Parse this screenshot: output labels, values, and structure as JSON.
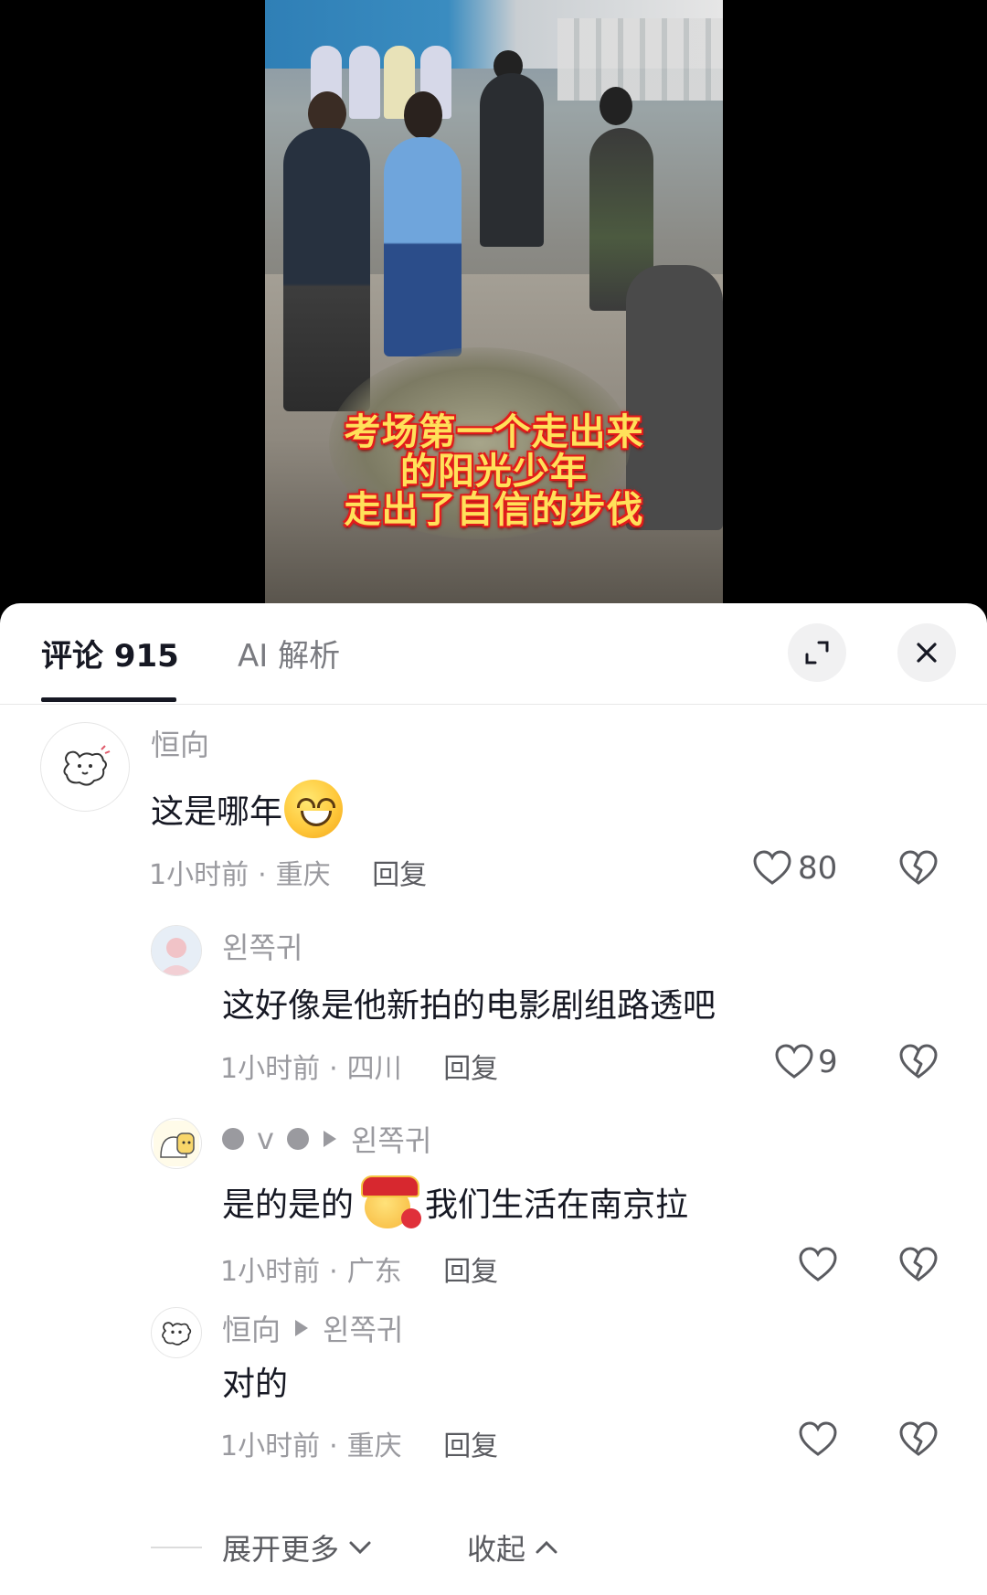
{
  "video": {
    "caption_lines": [
      "考场第一个走出来",
      "的阳光少年",
      "走出了自信的步伐"
    ]
  },
  "tabs": {
    "comments_label": "评论 915",
    "ai_label": "AI 解析"
  },
  "comments": [
    {
      "username": "恒向",
      "text": "这是哪年",
      "emoji": "grinning-face",
      "time": "1小时前",
      "location": "重庆",
      "reply_label": "回复",
      "likes": "80"
    }
  ],
  "replies": [
    {
      "username": "왼쪽귀",
      "text": "这好像是他新拍的电影剧组路透吧",
      "time": "1小时前",
      "location": "四川",
      "reply_label": "回复",
      "likes": "9"
    },
    {
      "username_part": "v",
      "reply_to": "왼쪽귀",
      "text_before": "是的是的",
      "emoji": "fortune-god",
      "text_after": "我们生活在南京拉",
      "time": "1小时前",
      "location": "广东",
      "reply_label": "回复",
      "likes": ""
    },
    {
      "username": "恒向",
      "reply_to": "왼쪽귀",
      "text": "对的",
      "time": "1小时前",
      "location": "重庆",
      "reply_label": "回复",
      "likes": ""
    }
  ],
  "footer": {
    "expand_label": "展开更多",
    "collapse_label": "收起"
  },
  "icons": {
    "expand": "expand-icon",
    "close": "close-icon",
    "like": "heart-icon",
    "dislike": "broken-heart-icon"
  }
}
